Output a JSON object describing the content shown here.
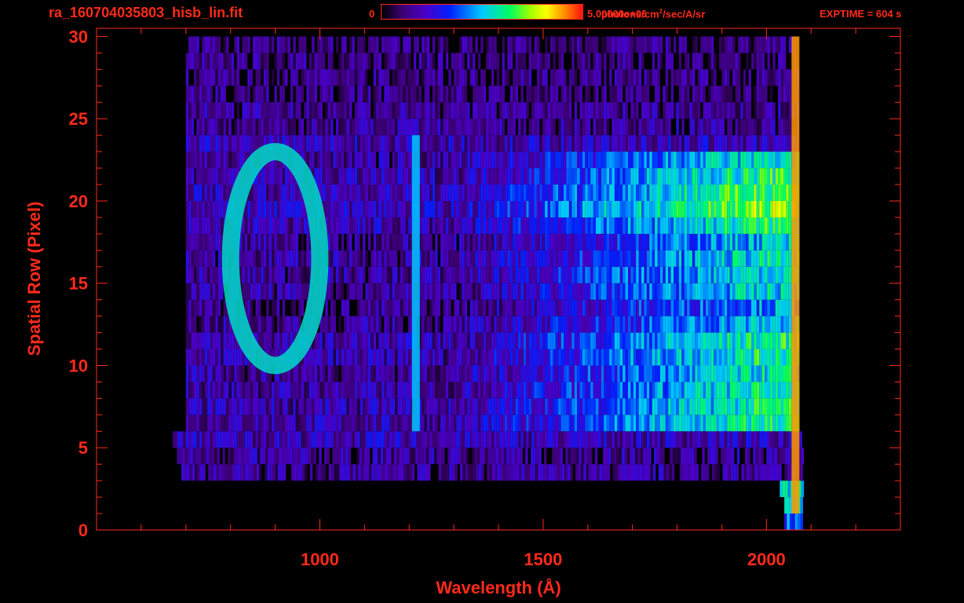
{
  "header": {
    "file_title": "ra_160704035803_hisb_lin.fit",
    "colorbar_min": "0",
    "colorbar_max": "5.00000e+06",
    "colorbar_units": "photons/cm",
    "colorbar_units_sup": "2",
    "colorbar_units_rest": "/sec/A/sr",
    "exptime": "EXPTIME = 604 s"
  },
  "colors": {
    "axis": "#ff2a1a",
    "background": "#000000"
  },
  "chart_data": {
    "type": "heatmap",
    "title": "ra_160704035803_hisb_lin.fit",
    "xlabel": "Wavelength (Å)",
    "ylabel": "Spatial Row (Pixel)",
    "xlim": [
      500,
      2300
    ],
    "ylim": [
      0,
      30.5
    ],
    "x_ticks": [
      1000,
      1500,
      2000
    ],
    "y_ticks": [
      0,
      5,
      10,
      15,
      20,
      25,
      30
    ],
    "colorbar": {
      "min": 0,
      "max": 5000000,
      "units": "photons/cm^2/sec/A/sr"
    },
    "rows": [
      {
        "y": 0,
        "x_start": 2040,
        "x_end": 2080,
        "level": 0.4
      },
      {
        "y": 1,
        "x_start": 2040,
        "x_end": 2080,
        "level": 0.5
      },
      {
        "y": 2,
        "x_start": 2030,
        "x_end": 2080,
        "level": 0.55
      },
      {
        "y": 3,
        "x_start": 690,
        "x_end": 2080,
        "level": 0.15
      },
      {
        "y": 4,
        "x_start": 680,
        "x_end": 2080,
        "level": 0.15
      },
      {
        "y": 5,
        "x_start": 670,
        "x_end": 2080,
        "level": 0.2
      },
      {
        "y": 6,
        "x_start": 700,
        "x_end": 2070,
        "level": 0.6
      },
      {
        "y": 7,
        "x_start": 700,
        "x_end": 2070,
        "level": 0.6
      },
      {
        "y": 8,
        "x_start": 700,
        "x_end": 2070,
        "level": 0.58
      },
      {
        "y": 9,
        "x_start": 700,
        "x_end": 2070,
        "level": 0.55
      },
      {
        "y": 10,
        "x_start": 700,
        "x_end": 2070,
        "level": 0.6
      },
      {
        "y": 11,
        "x_start": 700,
        "x_end": 2070,
        "level": 0.6
      },
      {
        "y": 12,
        "x_start": 700,
        "x_end": 2070,
        "level": 0.5
      },
      {
        "y": 13,
        "x_start": 700,
        "x_end": 2070,
        "level": 0.45
      },
      {
        "y": 14,
        "x_start": 700,
        "x_end": 2070,
        "level": 0.52
      },
      {
        "y": 15,
        "x_start": 700,
        "x_end": 2070,
        "level": 0.55
      },
      {
        "y": 16,
        "x_start": 700,
        "x_end": 2070,
        "level": 0.55
      },
      {
        "y": 17,
        "x_start": 700,
        "x_end": 2070,
        "level": 0.5
      },
      {
        "y": 18,
        "x_start": 700,
        "x_end": 2070,
        "level": 0.62
      },
      {
        "y": 19,
        "x_start": 700,
        "x_end": 2070,
        "level": 0.72
      },
      {
        "y": 20,
        "x_start": 700,
        "x_end": 2070,
        "level": 0.68
      },
      {
        "y": 21,
        "x_start": 700,
        "x_end": 2070,
        "level": 0.62
      },
      {
        "y": 22,
        "x_start": 700,
        "x_end": 2070,
        "level": 0.55
      },
      {
        "y": 23,
        "x_start": 700,
        "x_end": 2070,
        "level": 0.2
      },
      {
        "y": 24,
        "x_start": 700,
        "x_end": 2070,
        "level": 0.15
      },
      {
        "y": 25,
        "x_start": 700,
        "x_end": 2070,
        "level": 0.15
      },
      {
        "y": 26,
        "x_start": 700,
        "x_end": 2070,
        "level": 0.12
      },
      {
        "y": 27,
        "x_start": 700,
        "x_end": 2070,
        "level": 0.12
      },
      {
        "y": 28,
        "x_start": 700,
        "x_end": 2070,
        "level": 0.12
      },
      {
        "y": 29,
        "x_start": 700,
        "x_end": 2070,
        "level": 0.12
      }
    ],
    "features": [
      {
        "name": "ring",
        "cx": 900,
        "cy": 16.5,
        "rx": 100,
        "ry": 6.5,
        "level": 0.55
      },
      {
        "name": "line-1216",
        "x": 1215,
        "y_start": 6,
        "y_end": 24,
        "level": 0.5
      },
      {
        "name": "edge-2070",
        "x": 2065,
        "y_start": 1,
        "y_end": 30,
        "level": 0.9
      }
    ]
  }
}
